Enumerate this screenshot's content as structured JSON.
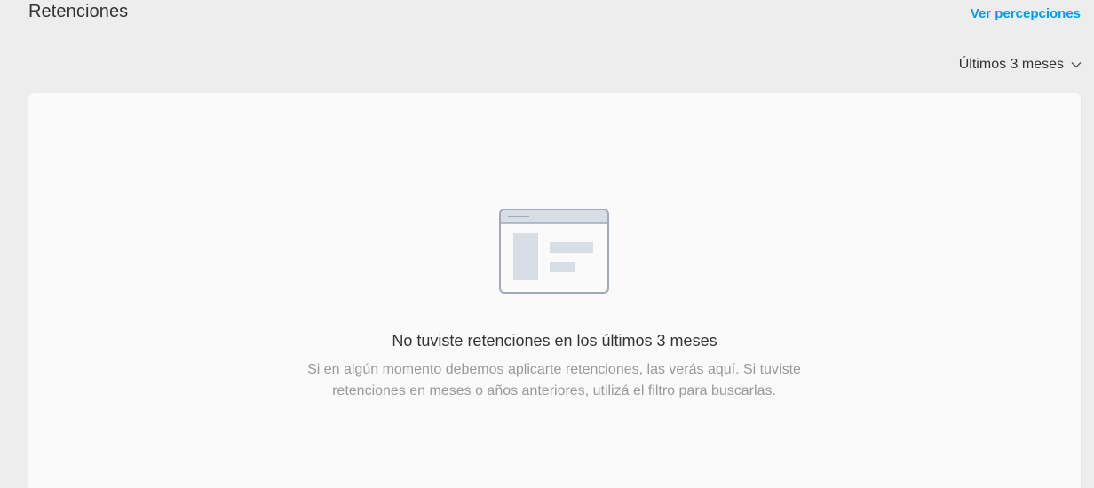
{
  "header": {
    "title": "Retenciones",
    "link_label": "Ver percepciones"
  },
  "filter": {
    "selected": "Últimos 3 meses",
    "icon": "chevron-down-icon"
  },
  "empty_state": {
    "icon": "browser-window-illustration",
    "title": "No tuviste retenciones en los últimos 3 meses",
    "description": "Si en algún momento debemos aplicarte retenciones, las verás aquí. Si tuviste retenciones en meses o años anteriores, utilizá el filtro para buscarlas."
  },
  "colors": {
    "background": "#ededed",
    "card": "#fafafa",
    "link": "#009ee3",
    "text_primary": "#333333",
    "text_secondary": "#999999",
    "illustration_stroke": "#a0aabb",
    "illustration_fill": "#d8dee6"
  }
}
